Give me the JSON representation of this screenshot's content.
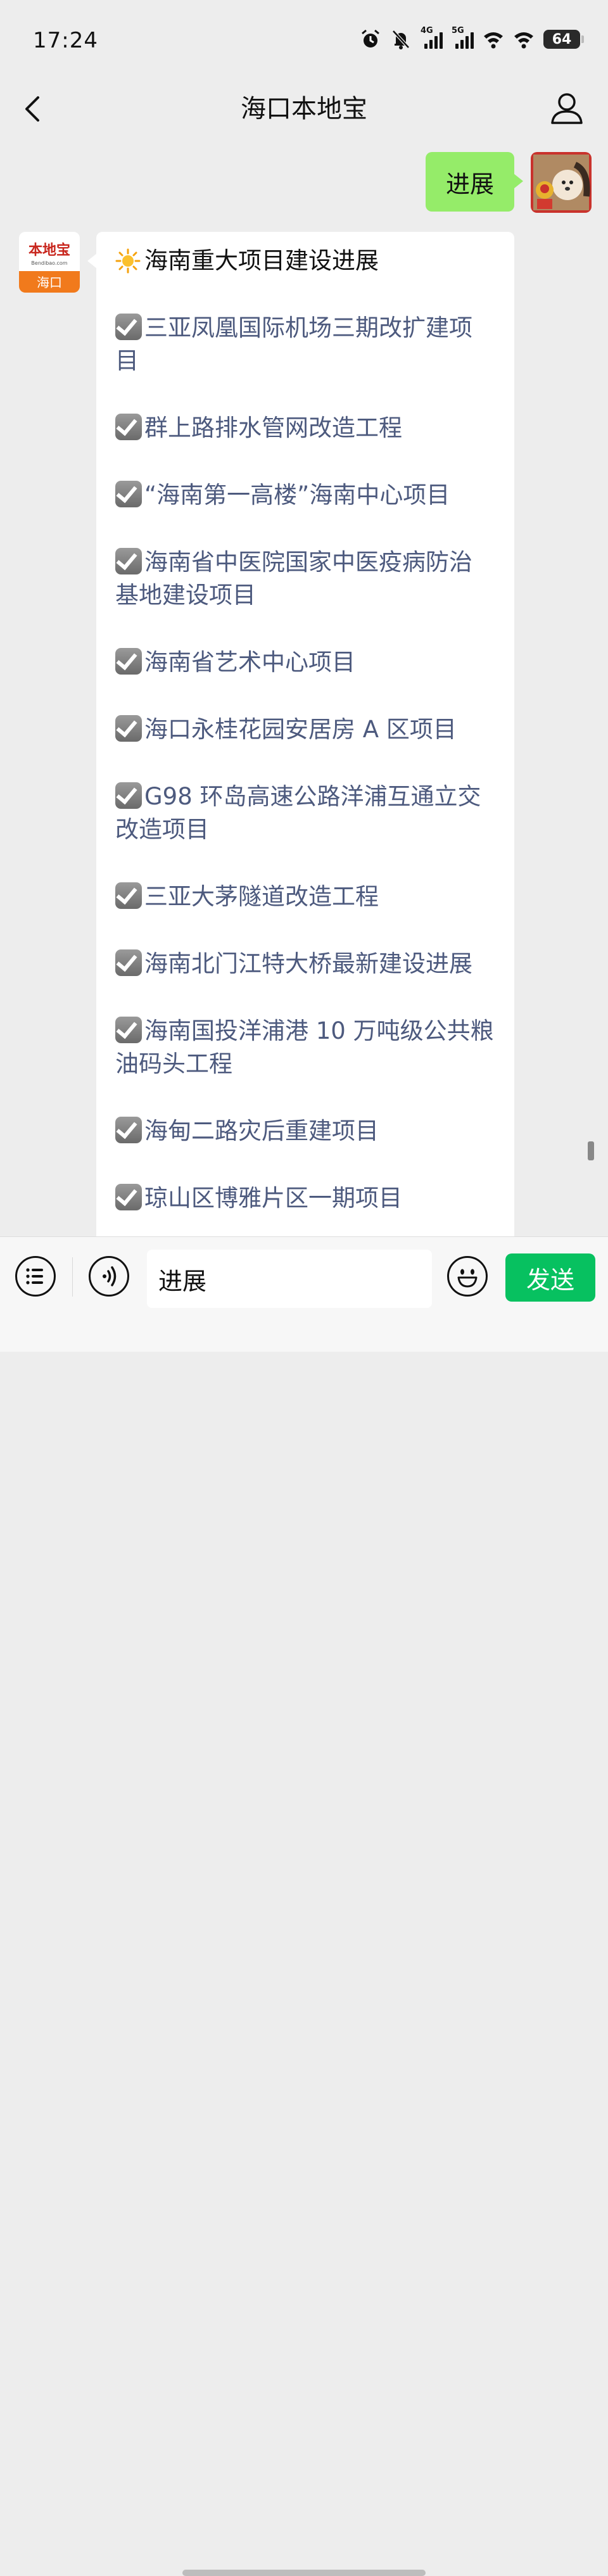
{
  "status_bar": {
    "time": "17:24",
    "net1": "4G",
    "net2": "5G",
    "battery": "64"
  },
  "nav": {
    "title": "海口本地宝"
  },
  "outgoing": {
    "text": "进展"
  },
  "bot": {
    "logo_text": "本地宝",
    "logo_sub": "Bendibao.com",
    "logo_city": "海口"
  },
  "reply": {
    "title": "海南重大项目建设进展",
    "items": [
      "三亚凤凰国际机场三期改扩建项目",
      "群上路排水管网改造工程",
      "“海南第一高楼”海南中心项目",
      "海南省中医院国家中医疫病防治基地建设项目",
      "海南省艺术中心项目",
      "海口永桂花园安居房 A 区项目",
      "G98 环岛高速公路洋浦互通立交改造项目",
      "三亚大茅隧道改造工程",
      "海南北门江特大桥最新建设进展",
      "海南国投洋浦港 10 万吨级公共粮油码头工程",
      "海甸二路灾后重建项目",
      "琼山区博雅片区一期项目"
    ]
  },
  "input_bar": {
    "value": "进展",
    "send_label": "发送"
  },
  "colors": {
    "outgoing_bubble": "#95ec69",
    "send_button": "#07c160",
    "item_text": "#4d5a7e",
    "background": "#ededed"
  },
  "icons": [
    "alarm-icon",
    "mute-icon",
    "signal-icon",
    "wifi-icon",
    "battery-icon",
    "back-icon",
    "profile-icon",
    "sun-icon",
    "checkbox-icon",
    "menu-icon",
    "voice-icon",
    "emoji-icon"
  ]
}
